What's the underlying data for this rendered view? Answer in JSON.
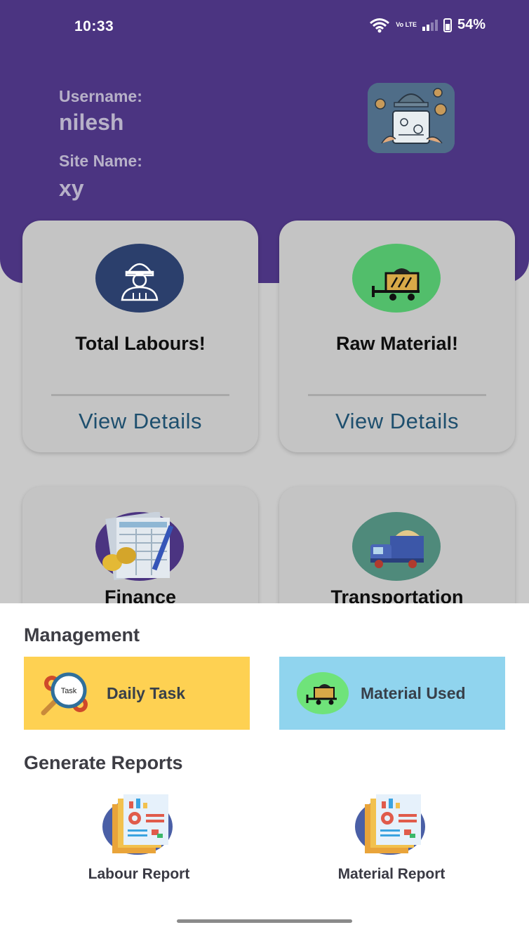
{
  "status_bar": {
    "time": "10:33",
    "volte": "Vo LTE",
    "battery": "54%"
  },
  "profile": {
    "username_label": "Username:",
    "username": "nilesh",
    "site_label": "Site Name:",
    "site_name": "xy"
  },
  "cards": [
    {
      "title": "Total Labours!",
      "link": "View Details",
      "icon": "worker-icon",
      "color": "#2b3f6c"
    },
    {
      "title": "Raw Material!",
      "link": "View Details",
      "icon": "cart-icon",
      "color": "#52be6b"
    },
    {
      "title": "Finance",
      "icon": "finance-icon",
      "color": "#4b3481"
    },
    {
      "title": "Transportation",
      "icon": "truck-icon",
      "color": "#4f8a7b"
    }
  ],
  "management": {
    "title": "Management",
    "tiles": [
      {
        "label": "Daily Task",
        "icon": "task-gear-icon",
        "icon_text": "Task",
        "color": "#fed152"
      },
      {
        "label": "Material Used",
        "icon": "material-cart-icon",
        "color": "#90d4ee"
      }
    ]
  },
  "reports": {
    "title": "Generate Reports",
    "items": [
      {
        "label": "Labour Report",
        "icon": "report-icon"
      },
      {
        "label": "Material Report",
        "icon": "report-icon"
      }
    ]
  }
}
